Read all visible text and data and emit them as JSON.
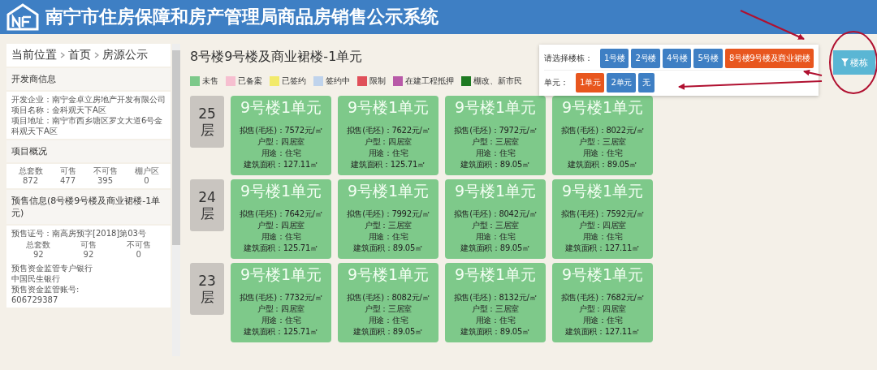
{
  "header": {
    "title": "南宁市住房保障和房产管理局商品房销售公示系统"
  },
  "sidebar": {
    "breadcrumb": [
      "当前位置",
      "首页",
      "房源公示"
    ],
    "developer": {
      "heading": "开发商信息",
      "lines": [
        "开发企业：南宁金卓立房地产开发有限公司",
        "项目名称：金科观天下A区",
        "项目地址：南宁市西乡塘区罗文大道6号金科观天下A区"
      ]
    },
    "overview": {
      "heading": "项目概况",
      "stats": [
        {
          "label": "总套数",
          "value": "872"
        },
        {
          "label": "可售",
          "value": "477"
        },
        {
          "label": "不可售",
          "value": "395"
        },
        {
          "label": "棚户区",
          "value": "0"
        }
      ]
    },
    "presale": {
      "heading": "预售信息(8号楼9号楼及商业裙楼-1单元)",
      "permit": "预售证号：南高房预字[2018]第03号",
      "stats": [
        {
          "label": "总套数",
          "value": "92"
        },
        {
          "label": "可售",
          "value": "92"
        },
        {
          "label": "不可售",
          "value": "0"
        }
      ],
      "bank_label": "预售资金监管专户银行",
      "bank": "中国民生银行",
      "account_label": "预售资金监管账号:",
      "account": "606729387"
    }
  },
  "main": {
    "title": "8号楼9号楼及商业裙楼-1单元",
    "legend": [
      {
        "label": "未售",
        "color": "#7dc98a"
      },
      {
        "label": "已备案",
        "color": "#f6bfd0"
      },
      {
        "label": "已签约",
        "color": "#f2ea6a"
      },
      {
        "label": "签约中",
        "color": "#bfd3ec"
      },
      {
        "label": "限制",
        "color": "#e0505a"
      },
      {
        "label": "在建工程抵押",
        "color": "#b85aa8"
      },
      {
        "label": "棚改、新市民",
        "color": "#1e7a22"
      }
    ],
    "floors": [
      {
        "floor": "25层",
        "rooms": [
          {
            "title": "9号楼1单元",
            "price": "拟售(毛坯)：7572元/㎡",
            "layout": "户型：四居室",
            "use": "用途：住宅",
            "area": "建筑面积：127.11㎡"
          },
          {
            "title": "9号楼1单元",
            "price": "拟售(毛坯)：7622元/㎡",
            "layout": "户型：四居室",
            "use": "用途：住宅",
            "area": "建筑面积：125.71㎡"
          },
          {
            "title": "9号楼1单元",
            "price": "拟售(毛坯)：7972元/㎡",
            "layout": "户型：三居室",
            "use": "用途：住宅",
            "area": "建筑面积：89.05㎡"
          },
          {
            "title": "9号楼1单元",
            "price": "拟售(毛坯)：8022元/㎡",
            "layout": "户型：三居室",
            "use": "用途：住宅",
            "area": "建筑面积：89.05㎡"
          }
        ]
      },
      {
        "floor": "24层",
        "rooms": [
          {
            "title": "9号楼1单元",
            "price": "拟售(毛坯)：7642元/㎡",
            "layout": "户型：四居室",
            "use": "用途：住宅",
            "area": "建筑面积：125.71㎡"
          },
          {
            "title": "9号楼1单元",
            "price": "拟售(毛坯)：7992元/㎡",
            "layout": "户型：三居室",
            "use": "用途：住宅",
            "area": "建筑面积：89.05㎡"
          },
          {
            "title": "9号楼1单元",
            "price": "拟售(毛坯)：8042元/㎡",
            "layout": "户型：三居室",
            "use": "用途：住宅",
            "area": "建筑面积：89.05㎡"
          },
          {
            "title": "9号楼1单元",
            "price": "拟售(毛坯)：7592元/㎡",
            "layout": "户型：四居室",
            "use": "用途：住宅",
            "area": "建筑面积：127.11㎡"
          }
        ]
      },
      {
        "floor": "23层",
        "rooms": [
          {
            "title": "9号楼1单元",
            "price": "拟售(毛坯)：7732元/㎡",
            "layout": "户型：四居室",
            "use": "用途：住宅",
            "area": "建筑面积：125.71㎡"
          },
          {
            "title": "9号楼1单元",
            "price": "拟售(毛坯)：8082元/㎡",
            "layout": "户型：三居室",
            "use": "用途：住宅",
            "area": "建筑面积：89.05㎡"
          },
          {
            "title": "9号楼1单元",
            "price": "拟售(毛坯)：8132元/㎡",
            "layout": "户型：三居室",
            "use": "用途：住宅",
            "area": "建筑面积：89.05㎡"
          },
          {
            "title": "9号楼1单元",
            "price": "拟售(毛坯)：7682元/㎡",
            "layout": "户型：四居室",
            "use": "用途：住宅",
            "area": "建筑面积：127.11㎡"
          }
        ]
      }
    ]
  },
  "selector": {
    "building_label": "请选择楼栋：",
    "buildings": [
      {
        "label": "1号楼",
        "selected": false
      },
      {
        "label": "2号楼",
        "selected": false
      },
      {
        "label": "4号楼",
        "selected": false
      },
      {
        "label": "5号楼",
        "selected": false
      },
      {
        "label": "8号楼9号楼及商业裙楼",
        "selected": true
      }
    ],
    "unit_label": "单元：",
    "units": [
      {
        "label": "1单元",
        "selected": true
      },
      {
        "label": "2单元",
        "selected": false
      },
      {
        "label": "无",
        "selected": false
      }
    ],
    "toggle": "楼栋"
  }
}
